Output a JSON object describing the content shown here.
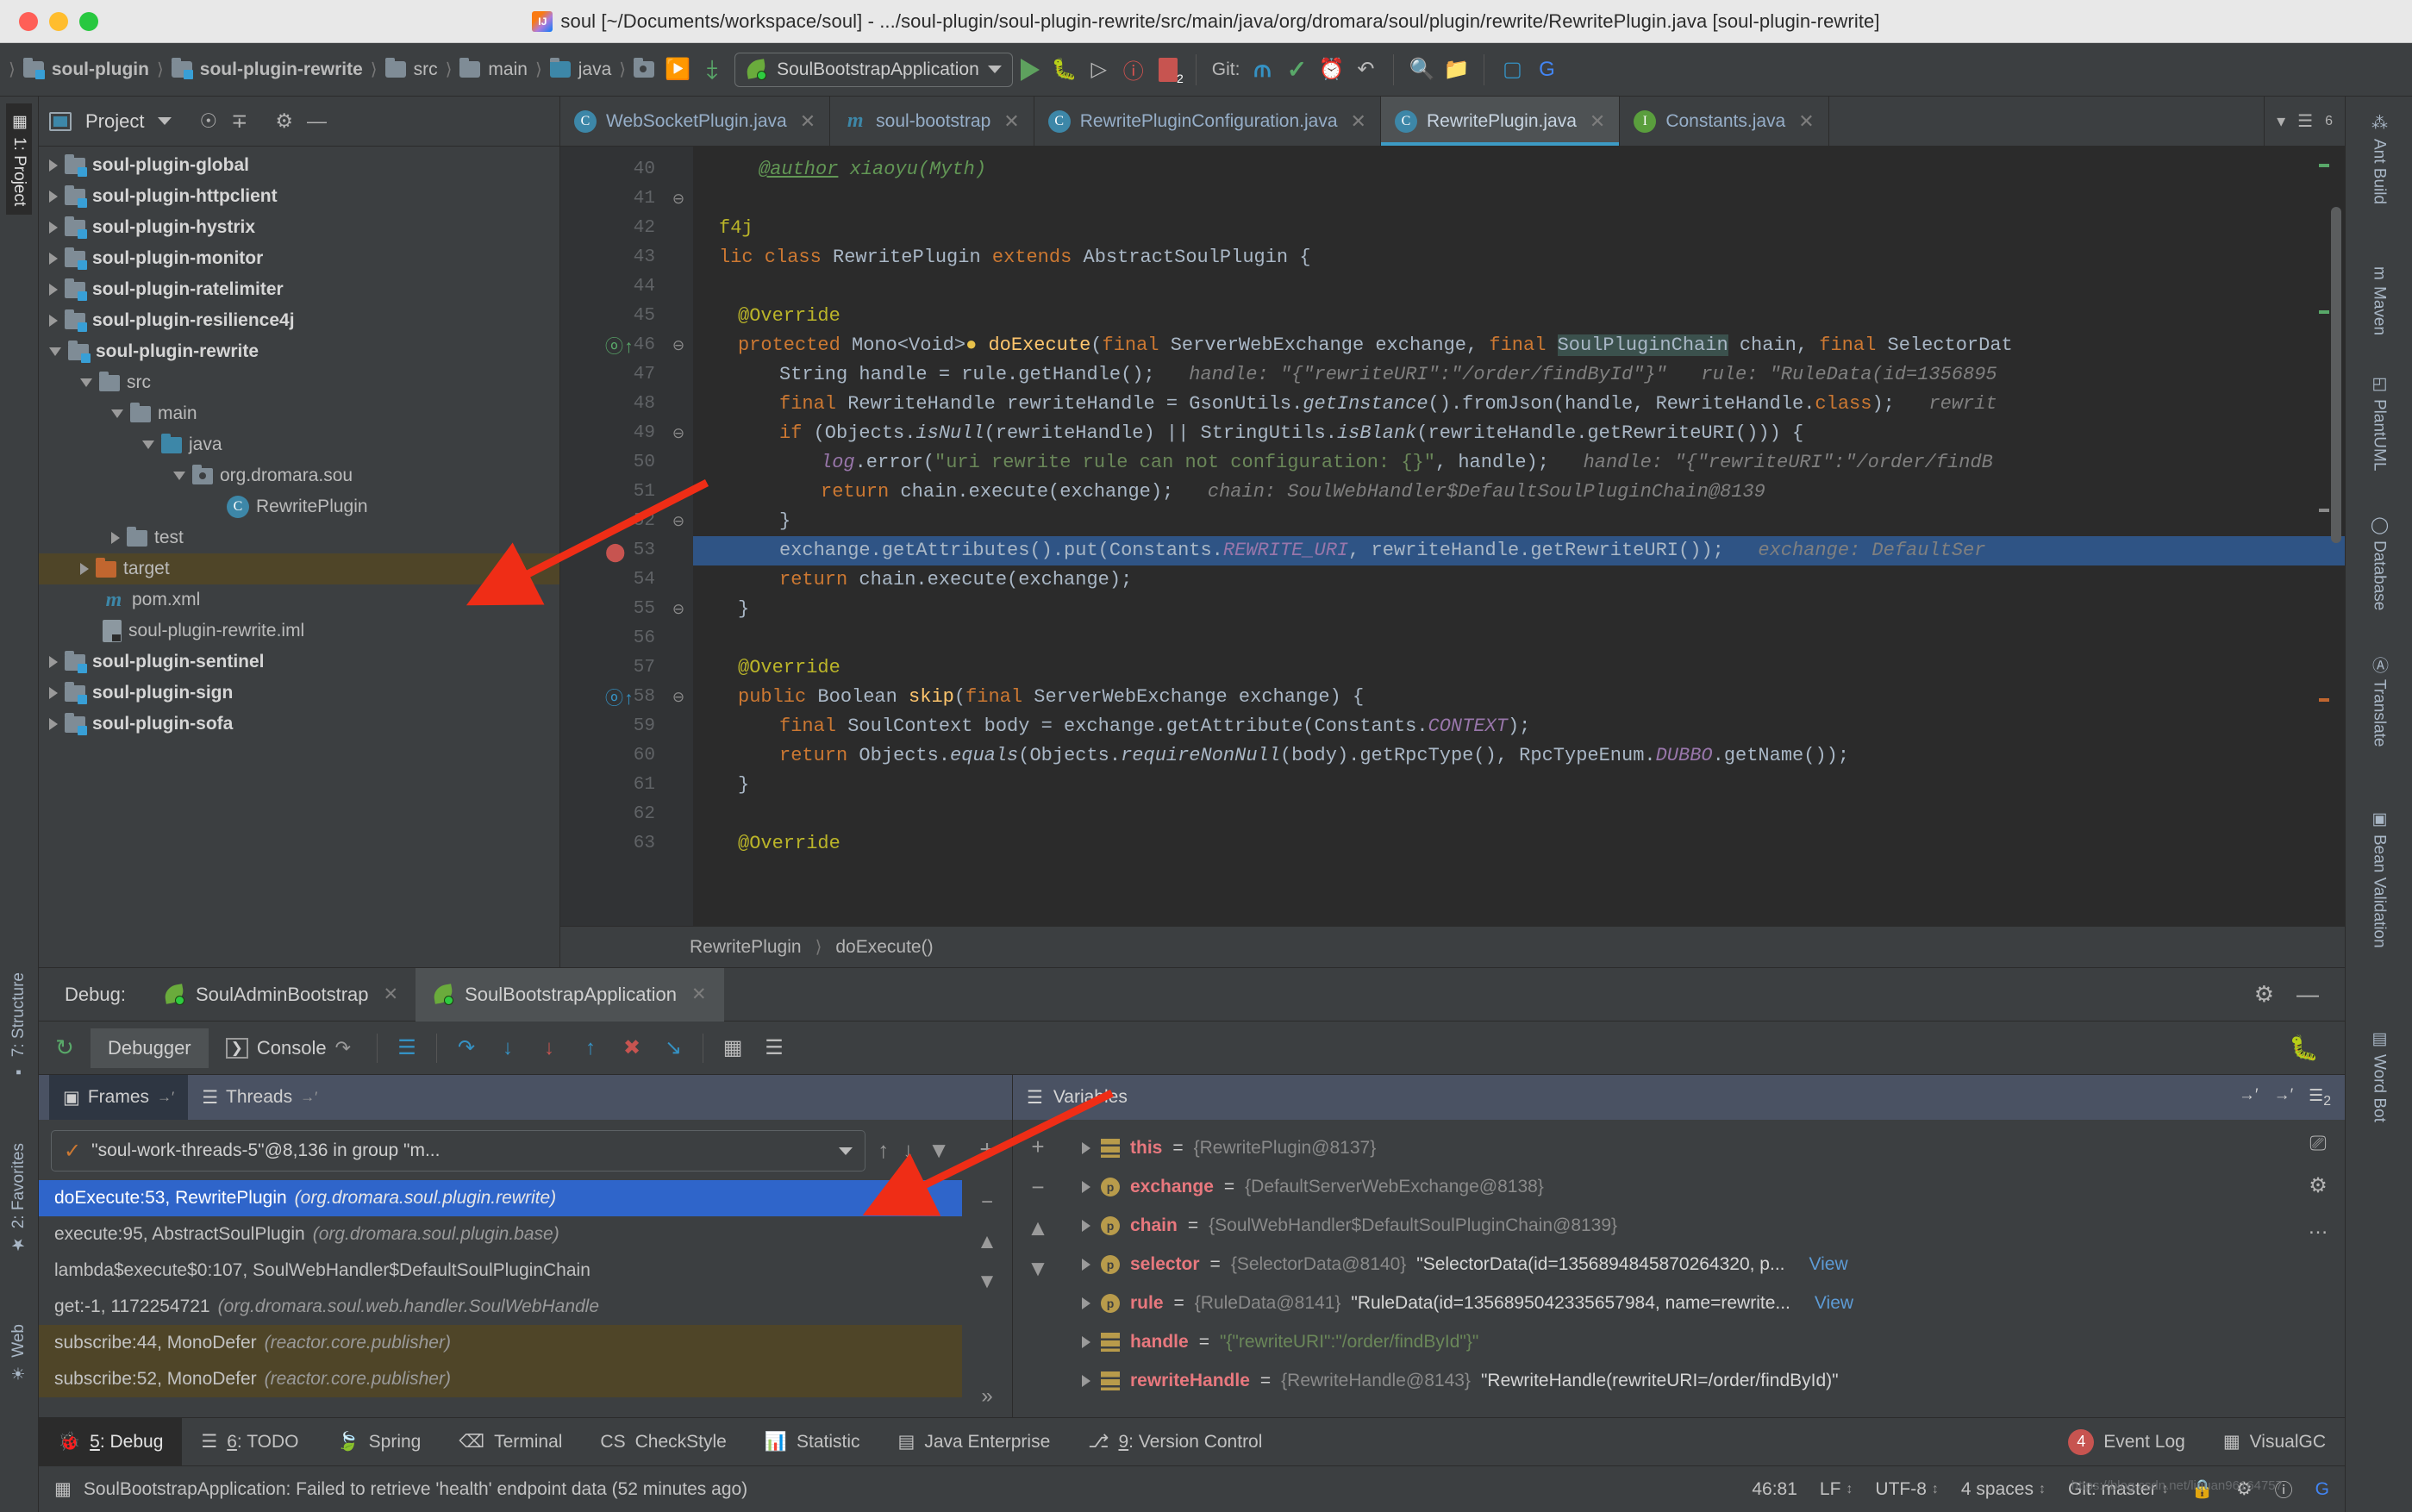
{
  "window": {
    "title": "soul [~/Documents/workspace/soul] - .../soul-plugin/soul-plugin-rewrite/src/main/java/org/dromara/soul/plugin/rewrite/RewritePlugin.java [soul-plugin-rewrite]",
    "app_icon": "intellij-idea-icon"
  },
  "navbar": {
    "breadcrumbs": [
      "soul-plugin",
      "soul-plugin-rewrite",
      "src",
      "main",
      "java"
    ],
    "run_config": "SoulBootstrapApplication",
    "git_label": "Git:",
    "error_badge": "2"
  },
  "project_pane": {
    "title": "Project",
    "tree": [
      {
        "label": "soul-plugin-global",
        "type": "module",
        "expanded": false,
        "indent": 0
      },
      {
        "label": "soul-plugin-httpclient",
        "type": "module",
        "expanded": false,
        "indent": 0
      },
      {
        "label": "soul-plugin-hystrix",
        "type": "module",
        "expanded": false,
        "indent": 0
      },
      {
        "label": "soul-plugin-monitor",
        "type": "module",
        "expanded": false,
        "indent": 0
      },
      {
        "label": "soul-plugin-ratelimiter",
        "type": "module",
        "expanded": false,
        "indent": 0
      },
      {
        "label": "soul-plugin-resilience4j",
        "type": "module",
        "expanded": false,
        "indent": 0
      },
      {
        "label": "soul-plugin-rewrite",
        "type": "module",
        "expanded": true,
        "indent": 0
      },
      {
        "label": "src",
        "type": "folder",
        "expanded": true,
        "indent": 1
      },
      {
        "label": "main",
        "type": "folder",
        "expanded": true,
        "indent": 2
      },
      {
        "label": "java",
        "type": "source-folder",
        "expanded": true,
        "indent": 3
      },
      {
        "label": "org.dromara.sou",
        "type": "package",
        "expanded": true,
        "indent": 4
      },
      {
        "label": "RewritePlugin",
        "type": "class",
        "expanded": null,
        "indent": 5
      },
      {
        "label": "test",
        "type": "folder",
        "expanded": false,
        "indent": 2
      },
      {
        "label": "target",
        "type": "target-folder",
        "expanded": false,
        "indent": 1,
        "selected": true
      },
      {
        "label": "pom.xml",
        "type": "maven",
        "expanded": null,
        "indent": 1
      },
      {
        "label": "soul-plugin-rewrite.iml",
        "type": "iml",
        "expanded": null,
        "indent": 1
      },
      {
        "label": "soul-plugin-sentinel",
        "type": "module",
        "expanded": false,
        "indent": 0
      },
      {
        "label": "soul-plugin-sign",
        "type": "module",
        "expanded": false,
        "indent": 0
      },
      {
        "label": "soul-plugin-sofa",
        "type": "module",
        "expanded": false,
        "indent": 0
      }
    ]
  },
  "editor": {
    "tabs": [
      {
        "label": "WebSocketPlugin.java",
        "icon": "class-icon",
        "active": false
      },
      {
        "label": "soul-bootstrap",
        "icon": "maven-icon",
        "active": false
      },
      {
        "label": "RewritePluginConfiguration.java",
        "icon": "class-icon",
        "active": false
      },
      {
        "label": "RewritePlugin.java",
        "icon": "class-icon",
        "active": true
      },
      {
        "label": "Constants.java",
        "icon": "interface-icon",
        "active": false
      }
    ],
    "tab_count_badge": "6",
    "first_line_number": 40,
    "lines": [
      {
        "n": 40,
        "text": "@author xiaoyu(Myth)"
      },
      {
        "n": 41,
        "text": ""
      },
      {
        "n": 42,
        "text": "f4j"
      },
      {
        "n": 43,
        "text": "lic class RewritePlugin extends AbstractSoulPlugin {"
      },
      {
        "n": 44,
        "text": ""
      },
      {
        "n": 45,
        "text": "@Override"
      },
      {
        "n": 46,
        "text": "protected Mono<Void> doExecute(final ServerWebExchange exchange, final SoulPluginChain chain, final SelectorDat"
      },
      {
        "n": 47,
        "text": "String handle = rule.getHandle();   handle: \"{\"rewriteURI\":\"/order/findById\"}\"   rule: \"RuleData(id=1356895"
      },
      {
        "n": 48,
        "text": "final RewriteHandle rewriteHandle = GsonUtils.getInstance().fromJson(handle, RewriteHandle.class);   rewrit"
      },
      {
        "n": 49,
        "text": "if (Objects.isNull(rewriteHandle) || StringUtils.isBlank(rewriteHandle.getRewriteURI())) {"
      },
      {
        "n": 50,
        "text": "log.error(\"uri rewrite rule can not configuration: {}\", handle);   handle: \"{\"rewriteURI\":\"/order/findB"
      },
      {
        "n": 51,
        "text": "return chain.execute(exchange);   chain: SoulWebHandler$DefaultSoulPluginChain@8139"
      },
      {
        "n": 52,
        "text": "}"
      },
      {
        "n": 53,
        "text": "exchange.getAttributes().put(Constants.REWRITE_URI, rewriteHandle.getRewriteURI());   exchange: DefaultSer",
        "highlighted": true
      },
      {
        "n": 54,
        "text": "return chain.execute(exchange);"
      },
      {
        "n": 55,
        "text": "}"
      },
      {
        "n": 56,
        "text": ""
      },
      {
        "n": 57,
        "text": "@Override"
      },
      {
        "n": 58,
        "text": "public Boolean skip(final ServerWebExchange exchange) {"
      },
      {
        "n": 59,
        "text": "final SoulContext body = exchange.getAttribute(Constants.CONTEXT);"
      },
      {
        "n": 60,
        "text": "return Objects.equals(Objects.requireNonNull(body).getRpcType(), RpcTypeEnum.DUBBO.getName());"
      },
      {
        "n": 61,
        "text": "}"
      },
      {
        "n": 62,
        "text": ""
      },
      {
        "n": 63,
        "text": "@Override"
      }
    ],
    "breadcrumb": [
      "RewritePlugin",
      "doExecute()"
    ]
  },
  "debug": {
    "label": "Debug:",
    "sessions": [
      {
        "label": "SoulAdminBootstrap",
        "active": false
      },
      {
        "label": "SoulBootstrapApplication",
        "active": true
      }
    ],
    "tabs": [
      {
        "label": "Debugger",
        "active": true
      },
      {
        "label": "Console",
        "active": false
      }
    ],
    "frames_tab": "Frames",
    "threads_tab": "Threads",
    "variables_title": "Variables",
    "thread_selector": "\"soul-work-threads-5\"@8,136 in group \"m...",
    "stack_frames": [
      {
        "method": "doExecute:53, RewritePlugin",
        "package": "(org.dromara.soul.plugin.rewrite)",
        "selected": true,
        "library": false
      },
      {
        "method": "execute:95, AbstractSoulPlugin",
        "package": "(org.dromara.soul.plugin.base)",
        "selected": false,
        "library": false
      },
      {
        "method": "lambda$execute$0:107, SoulWebHandler$DefaultSoulPluginChain",
        "package": "",
        "selected": false,
        "library": false
      },
      {
        "method": "get:-1, 1172254721",
        "package": "(org.dromara.soul.web.handler.SoulWebHandle",
        "selected": false,
        "library": false
      },
      {
        "method": "subscribe:44, MonoDefer",
        "package": "(reactor.core.publisher)",
        "selected": false,
        "library": true
      },
      {
        "method": "subscribe:52, MonoDefer",
        "package": "(reactor.core.publisher)",
        "selected": false,
        "library": true
      }
    ],
    "variables": [
      {
        "name": "this",
        "icon": "stack-icon",
        "eq": "=",
        "value": "{RewritePlugin@8137}",
        "value_kind": "ref",
        "extra": "",
        "view_link": ""
      },
      {
        "name": "exchange",
        "icon": "param-icon",
        "eq": "=",
        "value": "{DefaultServerWebExchange@8138}",
        "value_kind": "ref",
        "extra": "",
        "view_link": ""
      },
      {
        "name": "chain",
        "icon": "param-icon",
        "eq": "=",
        "value": "{SoulWebHandler$DefaultSoulPluginChain@8139}",
        "value_kind": "ref",
        "extra": "",
        "view_link": ""
      },
      {
        "name": "selector",
        "icon": "param-icon",
        "eq": "=",
        "value": "{SelectorData@8140}",
        "value_kind": "ref",
        "extra": "\"SelectorData(id=1356894845870264320, р...",
        "view_link": "View"
      },
      {
        "name": "rule",
        "icon": "param-icon",
        "eq": "=",
        "value": "{RuleData@8141}",
        "value_kind": "ref",
        "extra": "\"RuleData(id=1356895042335657984, name=rewrite...",
        "view_link": "View"
      },
      {
        "name": "handle",
        "icon": "stack-icon",
        "eq": "=",
        "value": "",
        "value_kind": "string",
        "extra": "\"{\"rewriteURI\":\"/order/findById\"}\"",
        "view_link": ""
      },
      {
        "name": "rewriteHandle",
        "icon": "stack-icon",
        "eq": "=",
        "value": "{RewriteHandle@8143}",
        "value_kind": "ref",
        "extra": "\"RewriteHandle(rewriteURI=/order/findById)\"",
        "view_link": ""
      }
    ]
  },
  "toolwindows_bottom": [
    {
      "label": "5: Debug",
      "num": "5",
      "rest": ": Debug",
      "icon": "debug-icon",
      "active": true
    },
    {
      "label": "6: TODO",
      "num": "6",
      "rest": ": TODO",
      "icon": "todo-icon",
      "active": false
    },
    {
      "label": "Spring",
      "num": "",
      "rest": "Spring",
      "icon": "spring-leaf-icon",
      "active": false
    },
    {
      "label": "Terminal",
      "num": "",
      "rest": "Terminal",
      "icon": "terminal-icon",
      "active": false
    },
    {
      "label": "CheckStyle",
      "num": "",
      "rest": "CheckStyle",
      "icon": "checkstyle-icon",
      "active": false
    },
    {
      "label": "Statistic",
      "num": "",
      "rest": "Statistic",
      "icon": "statistic-icon",
      "active": false
    },
    {
      "label": "Java Enterprise",
      "num": "",
      "rest": "Java Enterprise",
      "icon": "java-enterprise-icon",
      "active": false
    },
    {
      "label": "9: Version Control",
      "num": "9",
      "rest": ": Version Control",
      "icon": "version-control-icon",
      "active": false
    }
  ],
  "toolwindows_bottom_right": [
    {
      "label": "Event Log",
      "badge": "4",
      "icon": "event-log-icon"
    },
    {
      "label": "VisualGC",
      "badge": "",
      "icon": "visualgc-icon"
    }
  ],
  "left_strip": [
    {
      "label": "1: Project",
      "active": true
    },
    {
      "label": "7: Structure",
      "active": false
    },
    {
      "label": "2: Favorites",
      "active": false
    },
    {
      "label": "Web",
      "active": false
    }
  ],
  "right_strip": [
    {
      "label": "Ant Build",
      "icon": "ant-icon"
    },
    {
      "label": "Maven",
      "icon": "maven-icon"
    },
    {
      "label": "PlantUML",
      "icon": "plantuml-icon"
    },
    {
      "label": "Database",
      "icon": "database-icon"
    },
    {
      "label": "Translate",
      "icon": "translate-icon"
    },
    {
      "label": "Bean Validation",
      "icon": "bean-validation-icon"
    },
    {
      "label": "Word Bot",
      "icon": "word-bot-icon"
    }
  ],
  "statusbar": {
    "message": "SoulBootstrapApplication: Failed to retrieve 'health' endpoint data (52 minutes ago)",
    "caret": "46:81",
    "line_sep": "LF",
    "encoding": "UTF-8",
    "indent": "4 spaces",
    "branch": "Git: master",
    "watermark": "https://blog.csdn.net/liquan96164757"
  },
  "colors": {
    "accent_blue": "#3592c4",
    "selection_blue": "#2f65ca",
    "code_highlight": "#2f5485",
    "keyword_orange": "#cc7832",
    "string_green": "#6a8759",
    "annotation_yellow": "#bbb529",
    "comment_gray": "#808080",
    "panel_bg": "#3c3f41",
    "editor_bg": "#2b2b2b",
    "var_name_red": "#e8787e",
    "arrow_red": "#ef2d16"
  }
}
